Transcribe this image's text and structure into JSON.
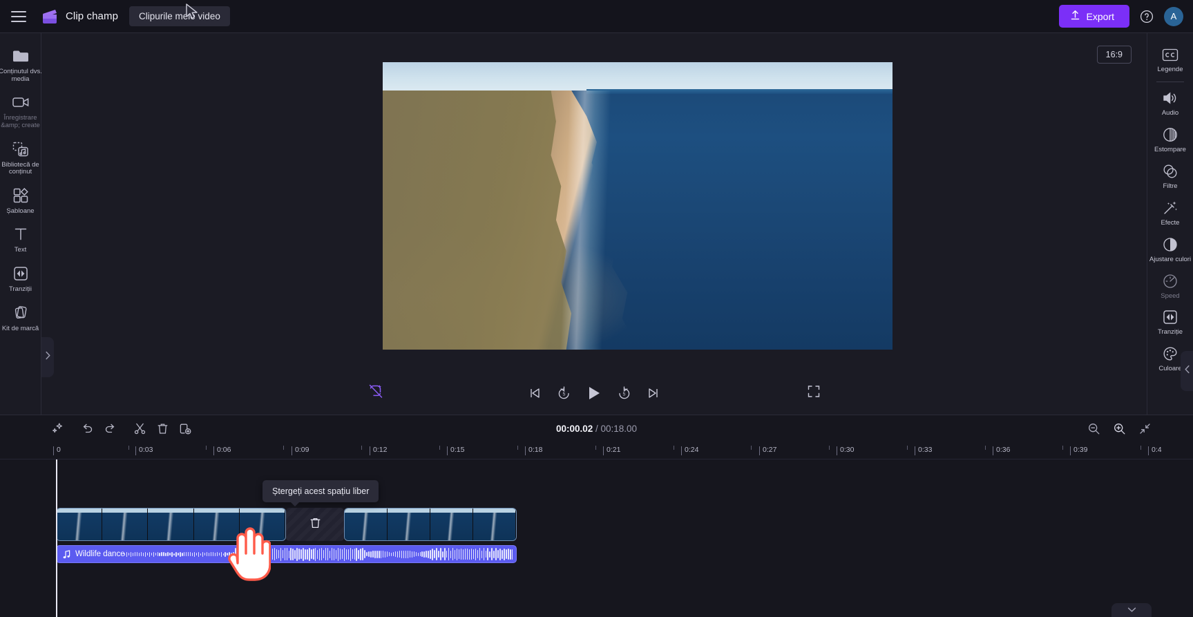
{
  "app": {
    "brand_name": "Clip champ",
    "project_tab": "Clipurile mele video",
    "export_label": "Export",
    "avatar_initial": "A",
    "menu_icon": "hamburger-icon",
    "help_icon": "help-circle-icon",
    "logo_icon": "clipchamp-logo-icon"
  },
  "left_rail": {
    "items": [
      {
        "label": "Conținutul dvs. media",
        "icon": "folder-icon",
        "dim": false
      },
      {
        "label": "Înregistrare &amp; create",
        "icon": "video-camera-icon",
        "dim": true
      },
      {
        "label": "Bibliotecă de conținut",
        "icon": "content-library-icon",
        "dim": false
      },
      {
        "label": "Șabloane",
        "icon": "templates-grid-icon",
        "dim": false
      },
      {
        "label": "Text",
        "icon": "text-t-icon",
        "dim": false
      },
      {
        "label": "Tranziții",
        "icon": "transitions-icon",
        "dim": false
      },
      {
        "label": "Kit de marcă",
        "icon": "brand-kit-icon",
        "dim": false
      }
    ]
  },
  "right_rail": {
    "items": [
      {
        "label": "Legende",
        "icon": "closed-caption-icon",
        "dim": false
      },
      {
        "label": "Audio",
        "icon": "speaker-icon",
        "dim": false
      },
      {
        "label": "Estompare",
        "icon": "fade-icon",
        "dim": false
      },
      {
        "label": "Filtre",
        "icon": "filters-icon",
        "dim": false
      },
      {
        "label": "Efecte",
        "icon": "magic-wand-icon",
        "dim": false
      },
      {
        "label": "Ajustare culori",
        "icon": "contrast-circle-icon",
        "dim": false
      },
      {
        "label": "Speed",
        "icon": "speedometer-icon",
        "dim": true
      },
      {
        "label": "Tranziție",
        "icon": "transitions-icon",
        "dim": false
      },
      {
        "label": "Culoare",
        "icon": "palette-icon",
        "dim": false
      }
    ]
  },
  "preview": {
    "aspect_ratio": "16:9",
    "autofix_icon": "autofix-off-icon",
    "fullscreen_icon": "fullscreen-icon",
    "controls": [
      {
        "name": "skip-to-start-button",
        "icon": "skip-previous-icon"
      },
      {
        "name": "rewind-5s-button",
        "icon": "replay-5-icon"
      },
      {
        "name": "play-button",
        "icon": "play-icon"
      },
      {
        "name": "forward-5s-button",
        "icon": "forward-5-icon"
      },
      {
        "name": "skip-to-end-button",
        "icon": "skip-next-icon"
      }
    ]
  },
  "timeline": {
    "current_time": "00:00.02",
    "separator": " / ",
    "total_time": "00:18.00",
    "toolbar": [
      {
        "name": "auto-compose-button",
        "icon": "sparkle-icon"
      },
      {
        "name": "undo-button",
        "icon": "undo-icon"
      },
      {
        "name": "redo-button",
        "icon": "redo-icon"
      },
      {
        "name": "split-button",
        "icon": "scissors-icon"
      },
      {
        "name": "delete-button",
        "icon": "trash-icon"
      },
      {
        "name": "duplicate-button",
        "icon": "duplicate-icon"
      }
    ],
    "zoom_controls": [
      {
        "name": "zoom-out-button",
        "icon": "magnifier-minus-icon"
      },
      {
        "name": "zoom-in-button",
        "icon": "magnifier-plus-icon"
      },
      {
        "name": "fit-to-screen-button",
        "icon": "fit-screen-icon"
      }
    ],
    "ruler_labels": [
      "0",
      "0:03",
      "0:06",
      "0:09",
      "0:12",
      "0:15",
      "0:18",
      "0:21",
      "0:24",
      "0:27",
      "0:30",
      "0:33",
      "0:36",
      "0:39",
      "0:4"
    ],
    "gap_tooltip": "Ștergeți acest spațiu liber",
    "gap_trash_icon": "trash-icon",
    "audio_track": {
      "name": "Wildlife dance",
      "icon": "music-note-icon",
      "color": "#5b5bf0"
    },
    "video_track_label": "video-clip"
  },
  "colors": {
    "accent": "#7b2ff7",
    "audio": "#5b5bf0",
    "background": "#1b1b24",
    "panel": "#16161e",
    "topbar": "#14141c",
    "cursor_outline": "#ff5b4a"
  }
}
